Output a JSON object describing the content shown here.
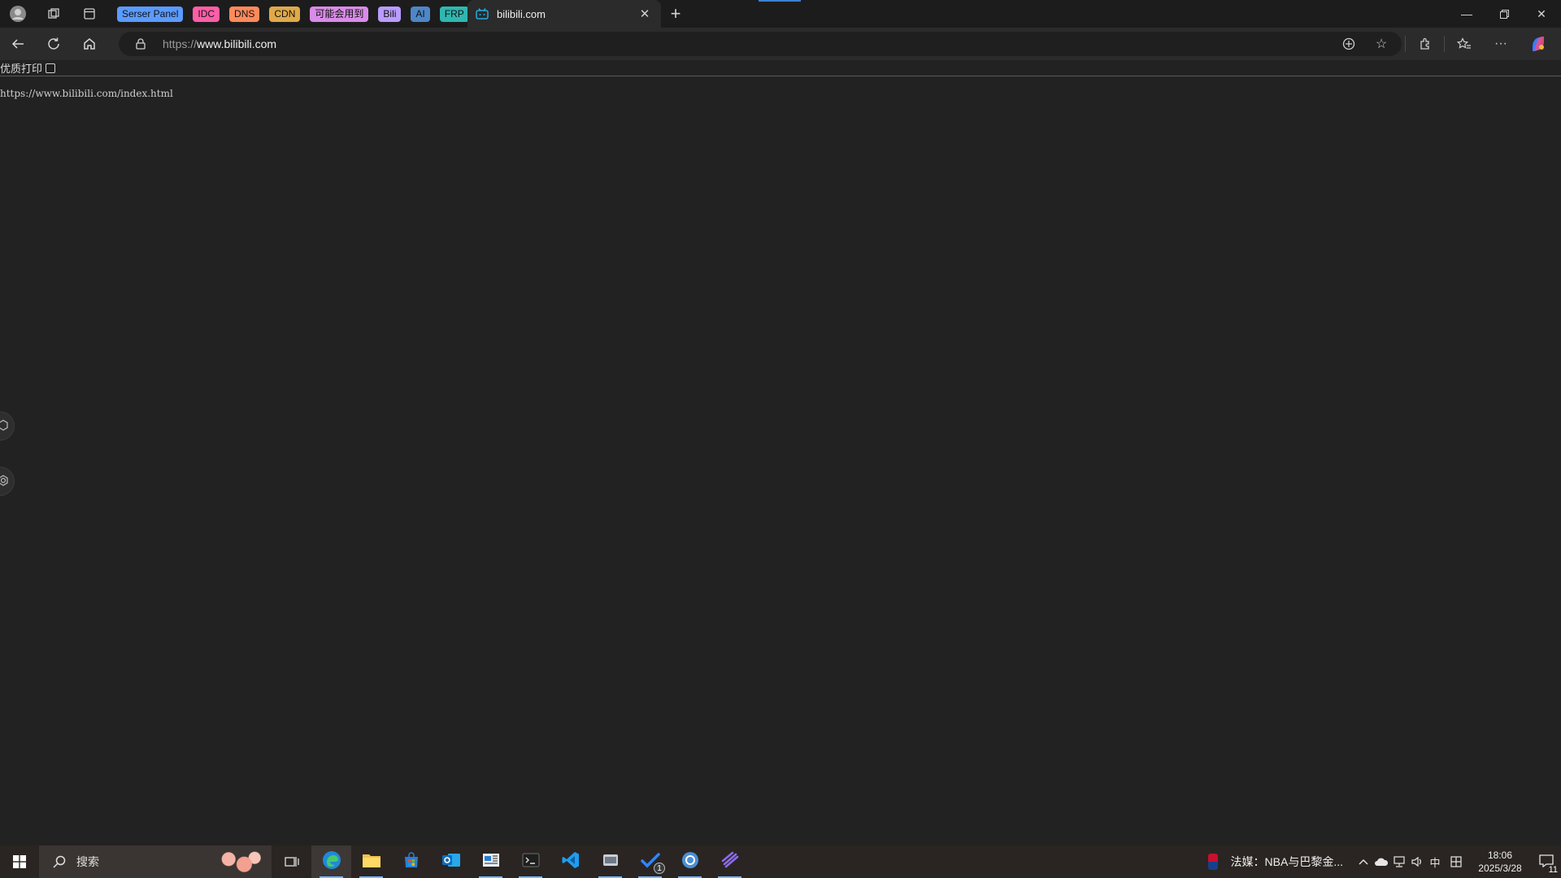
{
  "browser": {
    "tab_groups": [
      {
        "label": "Serser Panel",
        "color": "#5b9bff"
      },
      {
        "label": "IDC",
        "color": "#ff5ea8"
      },
      {
        "label": "DNS",
        "color": "#ff8a5b"
      },
      {
        "label": "CDN",
        "color": "#e0a94a"
      },
      {
        "label": "可能会用到",
        "color": "#d98be8"
      },
      {
        "label": "Bili",
        "color": "#b99cff"
      },
      {
        "label": "AI",
        "color": "#4e86c7"
      },
      {
        "label": "FRP",
        "color": "#2fb7b0"
      }
    ],
    "active_tab": {
      "title": "bilibili.com",
      "favicon": "bilibili-tv-icon"
    },
    "address": {
      "scheme": "https://",
      "host": "www.bilibili.com"
    },
    "accent": "#3b82d4"
  },
  "page": {
    "print_label": "优质打印",
    "print_checked": false,
    "url_text": "https://www.bilibili.com/index.html"
  },
  "taskbar": {
    "search_placeholder": "搜索",
    "apps": [
      {
        "name": "edge",
        "icon": "edge-icon",
        "active": true
      },
      {
        "name": "file-explorer",
        "icon": "folder-icon",
        "active": false
      },
      {
        "name": "store",
        "icon": "store-icon",
        "active": false
      },
      {
        "name": "outlook",
        "icon": "outlook-icon",
        "active": false
      },
      {
        "name": "news",
        "icon": "news-icon",
        "active": false
      },
      {
        "name": "terminal",
        "icon": "terminal-icon",
        "active": false
      },
      {
        "name": "vscode",
        "icon": "vscode-icon",
        "active": false
      },
      {
        "name": "app-8",
        "icon": "app-icon",
        "active": false
      },
      {
        "name": "todo",
        "icon": "todo-icon",
        "badge": "1",
        "active": false
      },
      {
        "name": "app-10",
        "icon": "app-icon",
        "active": false
      },
      {
        "name": "app-11",
        "icon": "app-icon",
        "active": false
      }
    ],
    "news_text": "法媒：NBA与巴黎金...",
    "ime": "中",
    "time": "18:06",
    "date": "2025/3/28",
    "notification_count": "11"
  }
}
